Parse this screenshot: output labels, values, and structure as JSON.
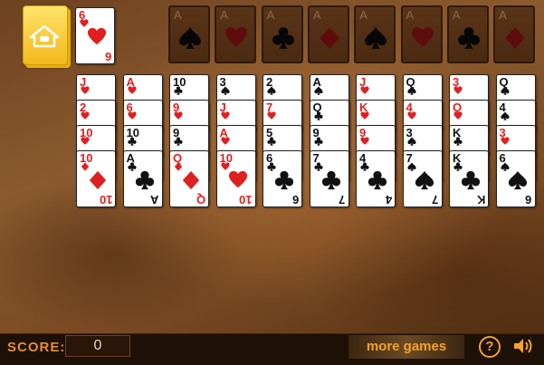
{
  "score": {
    "label": "SCORE:",
    "value": "0"
  },
  "more_games": "more games",
  "help": "?",
  "stock": {
    "rank": "6",
    "suit": "hearts",
    "color": "red"
  },
  "foundations": [
    {
      "rank": "A",
      "suit": "spades"
    },
    {
      "rank": "A",
      "suit": "hearts"
    },
    {
      "rank": "A",
      "suit": "clubs"
    },
    {
      "rank": "A",
      "suit": "diamonds"
    },
    {
      "rank": "A",
      "suit": "spades"
    },
    {
      "rank": "A",
      "suit": "hearts"
    },
    {
      "rank": "A",
      "suit": "clubs"
    },
    {
      "rank": "A",
      "suit": "diamonds"
    }
  ],
  "tableau": [
    [
      {
        "r": "J",
        "s": "hearts"
      },
      {
        "r": "2",
        "s": "hearts"
      },
      {
        "r": "10",
        "s": "hearts"
      },
      {
        "r": "10",
        "s": "diamonds"
      }
    ],
    [
      {
        "r": "A",
        "s": "hearts"
      },
      {
        "r": "6",
        "s": "hearts"
      },
      {
        "r": "10",
        "s": "clubs"
      },
      {
        "r": "A",
        "s": "clubs"
      }
    ],
    [
      {
        "r": "10",
        "s": "clubs"
      },
      {
        "r": "9",
        "s": "hearts"
      },
      {
        "r": "9",
        "s": "clubs"
      },
      {
        "r": "Q",
        "s": "diamonds"
      }
    ],
    [
      {
        "r": "3",
        "s": "spades"
      },
      {
        "r": "J",
        "s": "hearts"
      },
      {
        "r": "A",
        "s": "hearts"
      },
      {
        "r": "10",
        "s": "hearts"
      }
    ],
    [
      {
        "r": "2",
        "s": "spades"
      },
      {
        "r": "7",
        "s": "hearts"
      },
      {
        "r": "5",
        "s": "clubs"
      },
      {
        "r": "6",
        "s": "clubs"
      }
    ],
    [
      {
        "r": "A",
        "s": "spades"
      },
      {
        "r": "Q",
        "s": "clubs"
      },
      {
        "r": "9",
        "s": "clubs"
      },
      {
        "r": "7",
        "s": "clubs"
      }
    ],
    [
      {
        "r": "J",
        "s": "hearts"
      },
      {
        "r": "K",
        "s": "hearts"
      },
      {
        "r": "9",
        "s": "hearts"
      },
      {
        "r": "4",
        "s": "clubs"
      }
    ],
    [
      {
        "r": "Q",
        "s": "spades"
      },
      {
        "r": "4",
        "s": "hearts"
      },
      {
        "r": "3",
        "s": "spades"
      },
      {
        "r": "7",
        "s": "spades"
      }
    ],
    [
      {
        "r": "3",
        "s": "hearts"
      },
      {
        "r": "Q",
        "s": "hearts"
      },
      {
        "r": "K",
        "s": "clubs"
      },
      {
        "r": "K",
        "s": "clubs"
      }
    ],
    [
      {
        "r": "Q",
        "s": "spades"
      },
      {
        "r": "4",
        "s": "spades"
      },
      {
        "r": "3",
        "s": "hearts"
      },
      {
        "r": "6",
        "s": "spades"
      }
    ]
  ],
  "colors": {
    "red": "#e02020",
    "black": "#111111",
    "accent": "#f3a22a"
  }
}
